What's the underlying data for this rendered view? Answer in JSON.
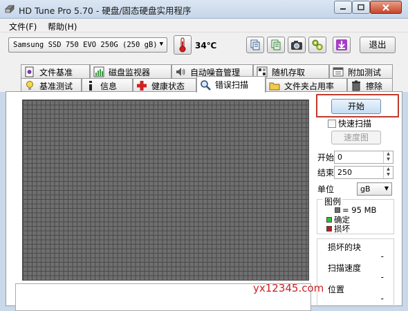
{
  "window": {
    "title": "HD Tune Pro 5.70 - 硬盘/固态硬盘实用程序"
  },
  "menu": [
    {
      "label": "文件(F)"
    },
    {
      "label": "帮助(H)"
    }
  ],
  "toolbar": {
    "drive": "Samsung SSD 750 EVO 250G (250 gB)",
    "temperature": "34℃",
    "exit_label": "退出",
    "icons": [
      "thermometer-icon",
      "copy-info-icon",
      "save-icon",
      "camera-icon",
      "options-icon",
      "download-icon"
    ]
  },
  "tabs_row1": [
    {
      "label": "文件基准",
      "icon": "file-benchmark-icon"
    },
    {
      "label": "磁盘监视器",
      "icon": "disk-monitor-icon"
    },
    {
      "label": "自动噪音管理",
      "icon": "speaker-icon"
    },
    {
      "label": "随机存取",
      "icon": "random-access-icon"
    },
    {
      "label": "附加测试",
      "icon": "extra-tests-icon"
    }
  ],
  "tabs_row2": [
    {
      "label": "基准测试",
      "icon": "benchmark-icon"
    },
    {
      "label": "信息",
      "icon": "info-icon"
    },
    {
      "label": "健康状态",
      "icon": "health-icon"
    },
    {
      "label": "错误扫描",
      "icon": "error-scan-icon",
      "active": true
    },
    {
      "label": "文件夹占用率",
      "icon": "folder-usage-icon"
    },
    {
      "label": "擦除",
      "icon": "erase-icon"
    }
  ],
  "scan": {
    "start_label": "开始",
    "quick_scan_label": "快速扫描",
    "quick_scan_checked": false,
    "speed_map_label": "速度图",
    "start_field_label": "开始",
    "start_value": "0",
    "end_field_label": "结束",
    "end_value": "250",
    "unit_label": "单位",
    "unit_value": "gB"
  },
  "legend": {
    "title": "图例",
    "block_size": "= 95 MB",
    "ok_label": "确定",
    "damaged_label": "损坏",
    "colors": {
      "block": "#6f6f6f",
      "ok": "#2fbf3a",
      "damaged": "#b81d1d"
    }
  },
  "stats": {
    "damaged_blocks_label": "损坏的块",
    "damaged_blocks_value": "-",
    "scan_speed_label": "扫描速度",
    "scan_speed_value": "-",
    "position_label": "位置",
    "position_value": "-"
  },
  "watermark": "yx12345.com"
}
